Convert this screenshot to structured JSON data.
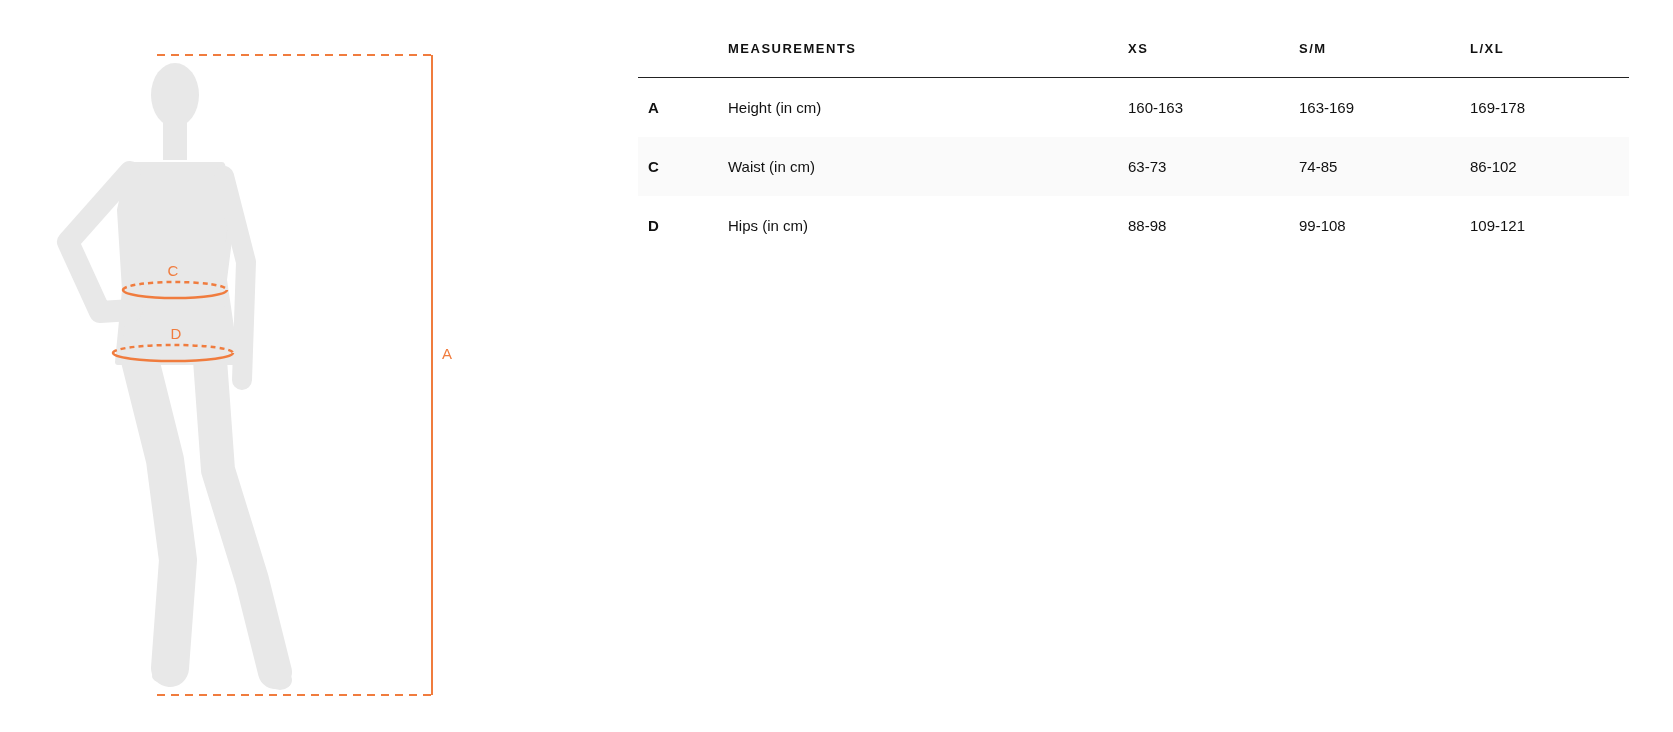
{
  "diagram": {
    "labels": [
      {
        "kind": "waist",
        "text": "C"
      },
      {
        "kind": "hips",
        "text": "D"
      },
      {
        "kind": "height",
        "text": "A"
      }
    ]
  },
  "table": {
    "columns": [
      "MEASUREMENTS",
      "XS",
      "S/M",
      "L/XL"
    ],
    "rows": [
      {
        "key": "A",
        "measurement": "Height (in cm)",
        "values": [
          "160-163",
          "163-169",
          "169-178"
        ]
      },
      {
        "key": "C",
        "measurement": "Waist (in cm)",
        "values": [
          "63-73",
          "74-85",
          "86-102"
        ]
      },
      {
        "key": "D",
        "measurement": "Hips (in cm)",
        "values": [
          "88-98",
          "99-108",
          "109-121"
        ]
      }
    ]
  }
}
